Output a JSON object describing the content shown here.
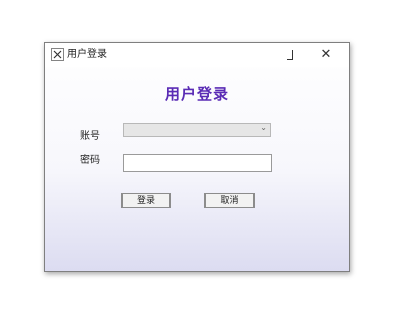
{
  "window": {
    "title": "用户登录",
    "minimize_label": "",
    "close_label": "✕"
  },
  "form": {
    "heading": "用户登录",
    "account_label": "账号",
    "account_value": "",
    "password_label": "密码",
    "password_value": ""
  },
  "buttons": {
    "login_label": "登录",
    "cancel_label": "取消"
  },
  "colors": {
    "heading": "#5a2bb5",
    "window_gradient_bottom": "#dcdcf1"
  }
}
